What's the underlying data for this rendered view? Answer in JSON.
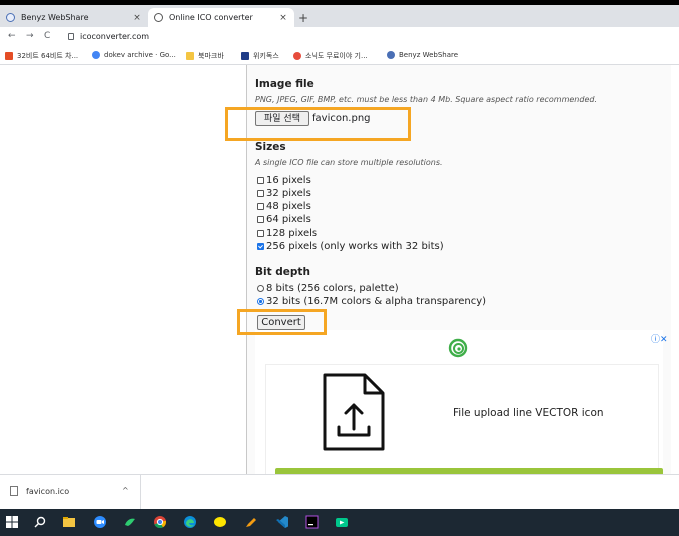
{
  "browser": {
    "tabs": [
      {
        "title": "Benyz WebShare",
        "active": false
      },
      {
        "title": "Online ICO converter",
        "active": true
      }
    ],
    "new_tab_glyph": "+",
    "close_glyph": "×",
    "url": "icoconverter.com",
    "nav": {
      "back": "←",
      "forward": "→",
      "reload": "C"
    },
    "bookmarks": [
      {
        "label": "32비트 64비트 차...",
        "icon": "d-icon",
        "color": "#e44d26"
      },
      {
        "label": "dokev archive · Go...",
        "icon": "google-icon",
        "color": "#4285f4"
      },
      {
        "label": "북마크바",
        "icon": "folder-icon",
        "color": "#f4c542"
      },
      {
        "label": "위키독스",
        "icon": "book-icon",
        "color": "#1f3c88"
      },
      {
        "label": "소닉도 무료이야 기...",
        "icon": "circle-icon",
        "color": "#e74c3c"
      },
      {
        "label": "Benyz WebShare",
        "icon": "globe-icon",
        "color": "#4a6fb5"
      }
    ]
  },
  "form": {
    "image_file": {
      "heading": "Image file",
      "note": "PNG, JPEG, GIF, BMP, etc. must be less than 4 Mb. Square aspect ratio recommended.",
      "button_label": "파일 선택",
      "file_name": "favicon.png"
    },
    "sizes": {
      "heading": "Sizes",
      "note": "A single ICO file can store multiple resolutions.",
      "options": [
        {
          "label": "16 pixels",
          "checked": false
        },
        {
          "label": "32 pixels",
          "checked": false
        },
        {
          "label": "48 pixels",
          "checked": false
        },
        {
          "label": "64 pixels",
          "checked": false
        },
        {
          "label": "128 pixels",
          "checked": false
        },
        {
          "label": "256 pixels (only works with 32 bits)",
          "checked": true
        }
      ]
    },
    "bit_depth": {
      "heading": "Bit depth",
      "options": [
        {
          "label": "8 bits (256 colors, palette)",
          "selected": false
        },
        {
          "label": "32 bits (16.7M colors & alpha transparency)",
          "selected": true
        }
      ]
    },
    "convert_label": "Convert"
  },
  "ad": {
    "info_glyph": "ⓘ✕",
    "text": "File upload line VECTOR icon",
    "accent": "#9ac53b"
  },
  "downloads": {
    "file_name": "favicon.ico",
    "chevron": "^"
  },
  "highlight_color": "#f5a623"
}
